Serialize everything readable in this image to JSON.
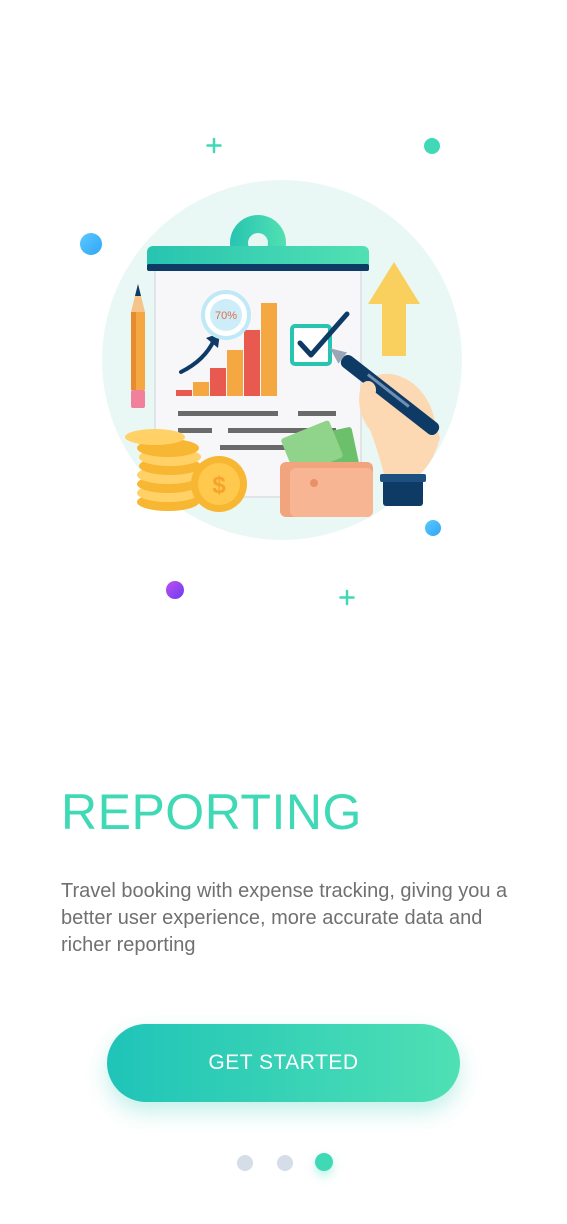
{
  "onboarding": {
    "title": "REPORTING",
    "description": "Travel booking with expense tracking, giving you a better user experience, more accurate data and richer reporting",
    "cta_label": "GET STARTED",
    "illustration": {
      "icon": "reporting-clipboard-illustration",
      "progress_badge": "70%"
    },
    "pager": {
      "total": 3,
      "active_index": 2
    }
  },
  "colors": {
    "accent": "#3fd9b6",
    "button_start": "#1fc4b8",
    "button_end": "#4fe0b4",
    "body_text": "#707070",
    "dot_inactive": "#d5dde8"
  }
}
